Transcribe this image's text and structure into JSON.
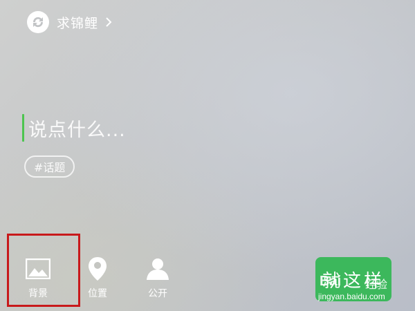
{
  "topic": {
    "title": "求锦鲤",
    "icon": "koi-swirl-icon",
    "chevron": "chevron-right-icon"
  },
  "compose": {
    "placeholder": "说点什么..."
  },
  "hashtag": {
    "label": "#话题"
  },
  "toolbar": {
    "items": [
      {
        "label": "背景",
        "icon": "image-icon"
      },
      {
        "label": "位置",
        "icon": "location-pin-icon"
      },
      {
        "label": "公开",
        "icon": "person-icon"
      }
    ]
  },
  "send": {
    "label": "就这样"
  },
  "watermark": {
    "brand": "Bai",
    "suffix": "经验",
    "url": "jingyan.baidu.com"
  },
  "colors": {
    "caret": "#4cc44f",
    "send_button": "#3cb85c",
    "highlight_box": "#c8191b"
  }
}
